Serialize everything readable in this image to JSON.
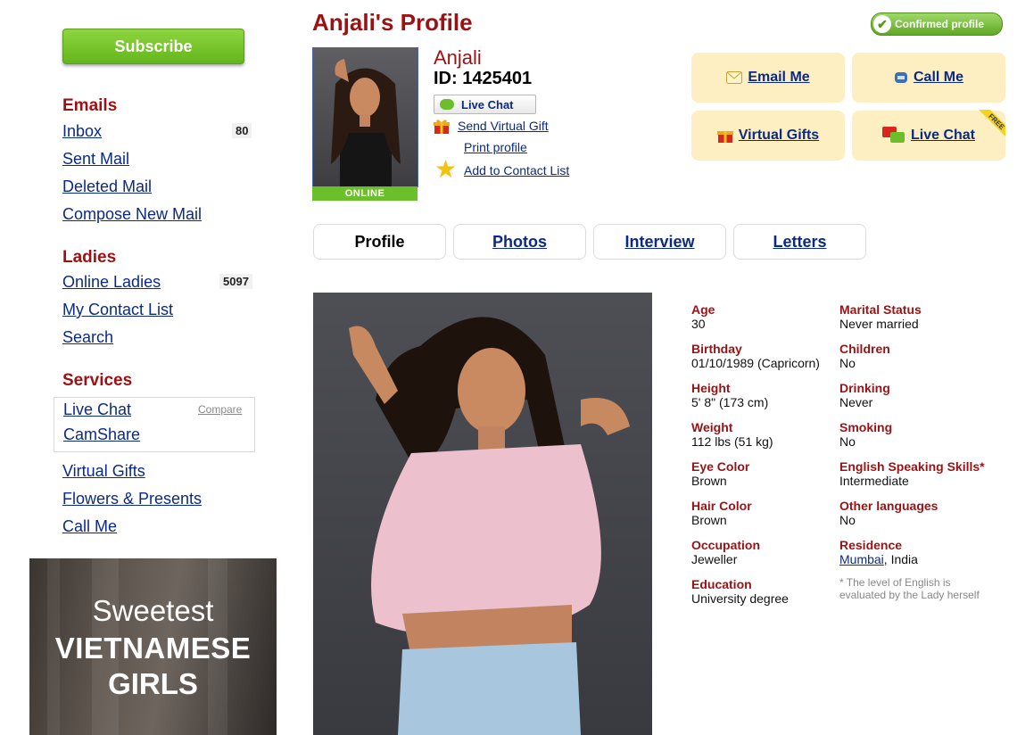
{
  "sidebar": {
    "subscribe_label": "Subscribe",
    "emails": {
      "title": "Emails",
      "items": [
        {
          "label": "Inbox",
          "count": "80"
        },
        {
          "label": "Sent Mail"
        },
        {
          "label": "Deleted Mail"
        },
        {
          "label": "Compose New Mail"
        }
      ]
    },
    "ladies": {
      "title": "Ladies",
      "items": [
        {
          "label": "Online Ladies",
          "count": "5097"
        },
        {
          "label": "My Contact List"
        },
        {
          "label": "Search"
        }
      ]
    },
    "services": {
      "title": "Services",
      "boxed_items": [
        "Live Chat",
        "CamShare"
      ],
      "compare_label": "Compare",
      "items": [
        "Virtual Gifts",
        "Flowers & Presents",
        "Call Me"
      ]
    },
    "banner": {
      "line1": "Sweetest",
      "line2": "VIETNAMESE",
      "line3": "GIRLS"
    }
  },
  "profile": {
    "page_title": "Anjali's Profile",
    "confirmed_label": "Confirmed profile",
    "name": "Anjali",
    "id_text": "ID: 1425401",
    "online_label": "ONLINE",
    "live_chat_small": "Live Chat",
    "send_gift": "Send Virtual Gift",
    "print_profile": "Print profile",
    "add_contact": "Add to Contact List"
  },
  "contact_buttons": {
    "email": "Email Me",
    "call": "Call Me",
    "gifts": "Virtual Gifts",
    "chat": "Live Chat",
    "free_badge": "FREE"
  },
  "tabs": [
    "Profile",
    "Photos",
    "Interview",
    "Letters"
  ],
  "details": {
    "left": [
      {
        "label": "Age",
        "value": "30"
      },
      {
        "label": "Birthday",
        "value": "01/10/1989 (Capricorn)"
      },
      {
        "label": "Height",
        "value": "5' 8\" (173 cm)"
      },
      {
        "label": "Weight",
        "value": "112 lbs (51 kg)"
      },
      {
        "label": "Eye Color",
        "value": "Brown"
      },
      {
        "label": "Hair Color",
        "value": "Brown"
      },
      {
        "label": "Occupation",
        "value": "Jeweller"
      },
      {
        "label": "Education",
        "value": "University degree"
      }
    ],
    "right": [
      {
        "label": "Marital Status",
        "value": "Never married"
      },
      {
        "label": "Children",
        "value": "No"
      },
      {
        "label": "Drinking",
        "value": "Never"
      },
      {
        "label": "Smoking",
        "value": "No"
      },
      {
        "label": "English Speaking Skills*",
        "value": "Intermediate"
      },
      {
        "label": "Other languages",
        "value": "No"
      },
      {
        "label": "Residence",
        "city": "Mumbai",
        "country": ", India"
      }
    ],
    "note": "* The level of English is evaluated by the Lady herself"
  },
  "colors": {
    "heading_red": "#9c1214",
    "link_blue": "#0b2a86",
    "button_green": "#6bbf2b",
    "contact_button_bg": "#fdefc2"
  }
}
